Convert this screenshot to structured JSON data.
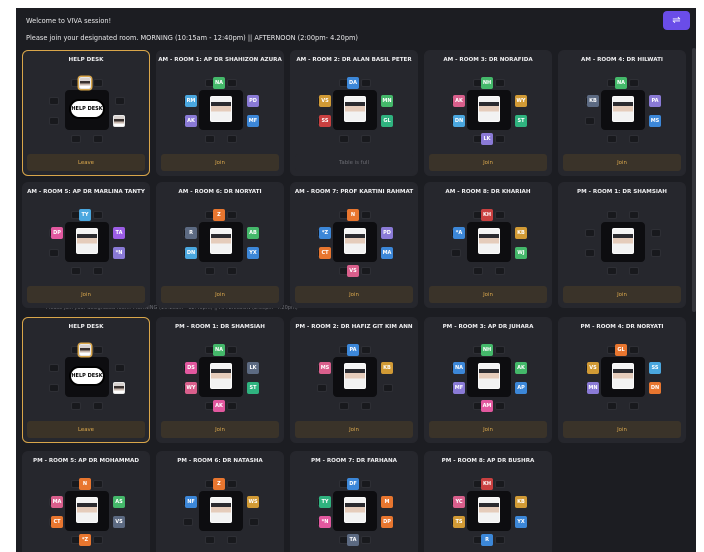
{
  "header": {
    "welcome": "Welcome to VIVA session!",
    "instructions": "Please join your designated room. MORNING (10:15am - 12:40pm) || AFTERNOON (2:00pm- 4.20pm)",
    "filter_icon": "sliders-icon"
  },
  "colors": {
    "accent": "#6a4de8",
    "gold": "#d9a64a",
    "bg": "#1c1d22",
    "card": "#26272d"
  },
  "rooms": [
    {
      "title": "HELP DESK",
      "button": "Leave",
      "kind": "helpdesk"
    },
    {
      "title": "AM - ROOM 1: AP DR SHAHIZON AZURA",
      "button": "Join",
      "seats": [
        "NA",
        "PD",
        "RM",
        "MF",
        "AK"
      ]
    },
    {
      "title": "AM - ROOM 2: DR ALAN BASIL PETER",
      "button": "Table is full",
      "seats": [
        "DA",
        "MN",
        "VS",
        "GL",
        "SS"
      ]
    },
    {
      "title": "AM - ROOM 3: DR NORAFIDA",
      "button": "Join",
      "seats": [
        "NH",
        "WY",
        "AK",
        "ST",
        "DN",
        "LK"
      ]
    },
    {
      "title": "AM - ROOM 4: DR HILWATI",
      "button": "Join",
      "seats": [
        "NA",
        "PA",
        "KB",
        "MS"
      ]
    },
    {
      "title": "AM - ROOM 5: AP DR MARLINA TANTY",
      "button": "Join",
      "seats": [
        "TY",
        "TA",
        "DP",
        "*N"
      ]
    },
    {
      "title": "AM - ROOM 6: DR NORYATI",
      "button": "Join",
      "seats": [
        "Z",
        "AB",
        "R",
        "YX",
        "DN"
      ]
    },
    {
      "title": "AM - ROOM 7: PROF KARTINI RAHMAT",
      "button": "Join",
      "seats": [
        "N",
        "PD",
        "*Z",
        "MA",
        "CT",
        "VS"
      ]
    },
    {
      "title": "AM - ROOM 8: DR KHARIAH",
      "button": "Join",
      "seats": [
        "KH",
        "KB",
        "*A",
        "WJ"
      ]
    },
    {
      "title": "PM - ROOM 1: DR SHAMSIAH",
      "button": "Join",
      "seats": []
    },
    {
      "title": "HELP DESK",
      "button": "Leave",
      "kind": "helpdesk"
    },
    {
      "title": "PM - ROOM 1: DR SHAMSIAH",
      "button": "Join",
      "seats": [
        "NA",
        "LK",
        "DS",
        "ST",
        "WY",
        "AK"
      ]
    },
    {
      "title": "PM - ROOM 2: DR HAFIZ GIT KIM ANN",
      "button": "Join",
      "seats": [
        "PA",
        "KB",
        "MS"
      ]
    },
    {
      "title": "PM - ROOM 3: AP DR JUHARA",
      "button": "Join",
      "seats": [
        "NH",
        "AK",
        "NA",
        "AP",
        "MF",
        "AM"
      ]
    },
    {
      "title": "PM - ROOM 4: DR NORYATI",
      "button": "Join",
      "seats": [
        "GL",
        "SS",
        "VS",
        "DN",
        "MN"
      ]
    },
    {
      "title": "PM - ROOM 5: AP DR MOHAMMAD",
      "button": "",
      "seats": [
        "N",
        "AS",
        "MA",
        "VS",
        "CT",
        "*Z"
      ]
    },
    {
      "title": "PM - ROOM 6: DR NATASHA",
      "button": "",
      "seats": [
        "Z",
        "WS",
        "NF"
      ]
    },
    {
      "title": "PM - ROOM 7: DR FARHANA",
      "button": "",
      "seats": [
        "DF",
        "M",
        "TY",
        "DP",
        "*N",
        "TA"
      ]
    },
    {
      "title": "PM - ROOM 8: AP DR BUSHRA",
      "button": "",
      "seats": [
        "KH",
        "KB",
        "YC",
        "YX",
        "TS",
        "R"
      ]
    }
  ],
  "logo_text": "HELP DESK"
}
